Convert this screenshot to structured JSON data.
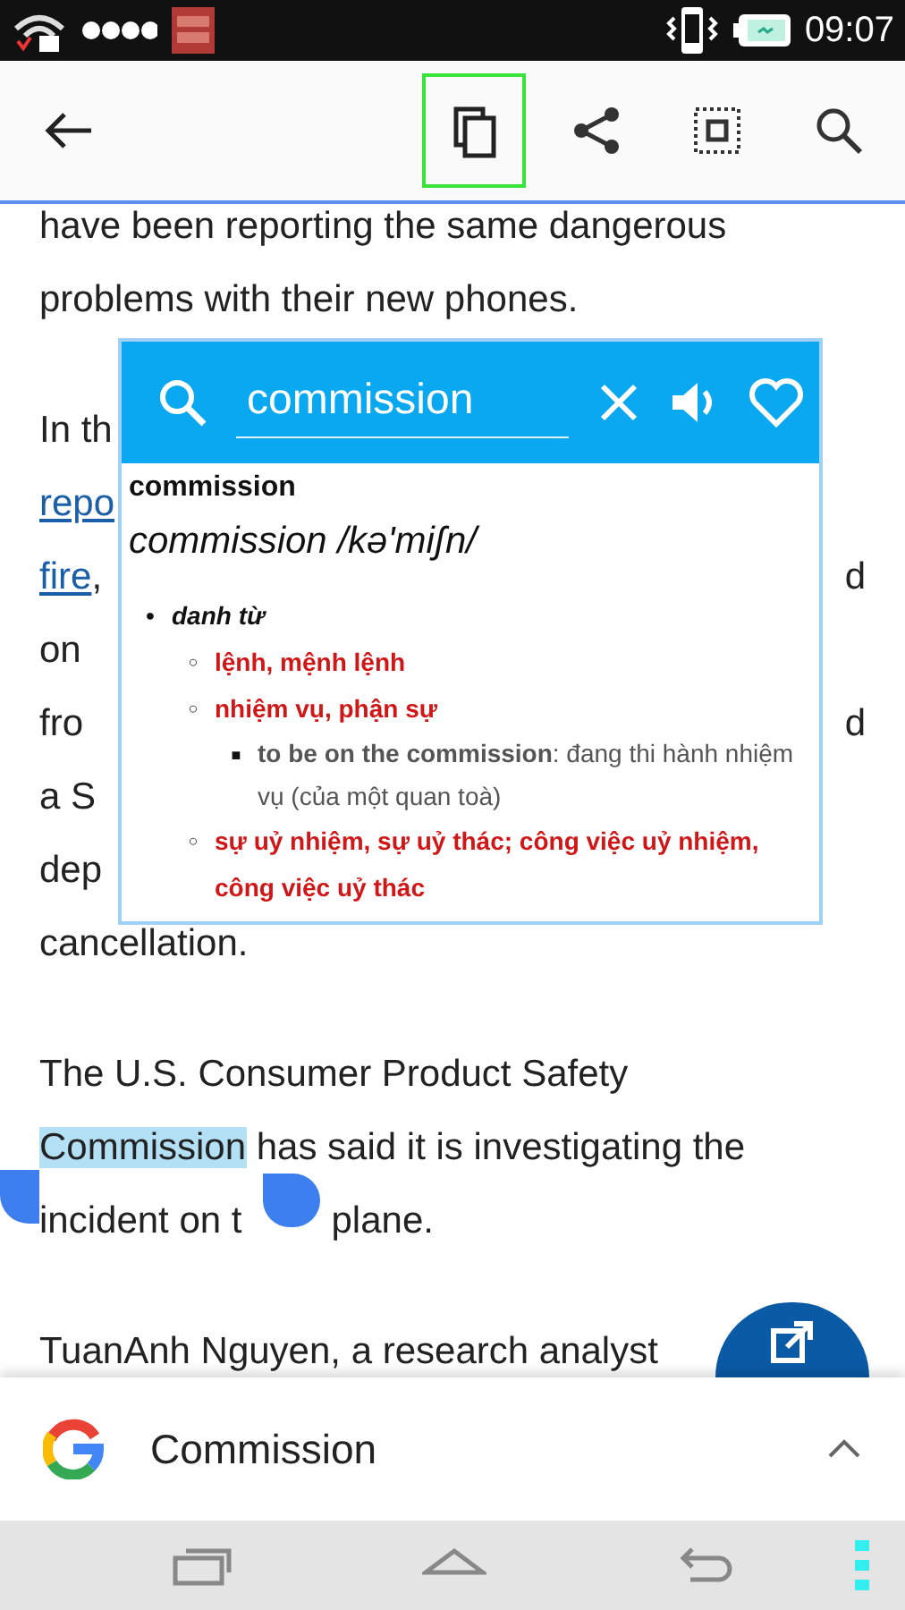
{
  "status_bar": {
    "time": "09:07"
  },
  "toolbar": {
    "buttons": [
      {
        "kind": "back",
        "selected": false
      },
      {
        "kind": "copy",
        "selected": true
      },
      {
        "kind": "share",
        "selected": false
      },
      {
        "kind": "select-all",
        "selected": false
      },
      {
        "kind": "search",
        "selected": false
      }
    ]
  },
  "article": {
    "paragraphs": [
      {
        "lines": [
          {
            "left": [
              {
                "text": "have been reporting the same dangerous",
                "kind": "plain"
              }
            ]
          },
          {
            "left": [
              {
                "text": "problems with their new phones.",
                "kind": "plain"
              }
            ]
          }
        ]
      },
      {
        "lines": [
          {
            "left": [
              {
                "text": "In th",
                "kind": "plain"
              }
            ]
          },
          {
            "left": [
              {
                "text": "repo",
                "kind": "link"
              }
            ]
          },
          {
            "left": [
              {
                "text": "fire",
                "kind": "link"
              },
              {
                "text": ",",
                "kind": "plain"
              }
            ],
            "right": [
              {
                "text": "d",
                "kind": "plain"
              }
            ]
          },
          {
            "left": [
              {
                "text": "on",
                "kind": "plain"
              }
            ]
          },
          {
            "left": [
              {
                "text": "fro",
                "kind": "plain"
              }
            ],
            "right": [
              {
                "text": "d",
                "kind": "plain"
              }
            ]
          },
          {
            "left": [
              {
                "text": "a S",
                "kind": "plain"
              }
            ]
          },
          {
            "left": [
              {
                "text": "dep",
                "kind": "plain"
              }
            ]
          },
          {
            "left": [
              {
                "text": "cancellation.",
                "kind": "plain"
              }
            ]
          }
        ]
      },
      {
        "lines": [
          {
            "left": [
              {
                "text": "The U.S. Consumer Product Safety",
                "kind": "plain"
              }
            ]
          },
          {
            "left": [
              {
                "text": "Commission",
                "kind": "highlight"
              },
              {
                "text": " has said it is investigating the",
                "kind": "plain"
              }
            ]
          },
          {
            "left": [
              {
                "text": "incident on t",
                "kind": "plain"
              },
              {
                "kind": "handle"
              },
              {
                "text": "plane.",
                "kind": "plain"
              }
            ]
          }
        ]
      },
      {
        "lines": [
          {
            "left": [
              {
                "text": "TuanAnh Nguyen, a research analyst",
                "kind": "plain"
              }
            ]
          }
        ]
      }
    ]
  },
  "popup": {
    "query": "commission",
    "headword": "commission",
    "pronunciation": "commission /kə'miʃn/",
    "entries": [
      {
        "marker": "●",
        "text": "danh từ",
        "kind": "pos",
        "children": [
          {
            "marker": "○",
            "text": "lệnh, mệnh lệnh",
            "kind": "meaning"
          },
          {
            "marker": "○",
            "text": "nhiệm vụ, phận sự",
            "kind": "meaning",
            "children": [
              {
                "marker": "■",
                "text": "**to be on the commission**: đang thi hành nhiệm vụ (của một quan toà)",
                "kind": "example"
              }
            ]
          },
          {
            "marker": "○",
            "text": "sự uỷ nhiệm, sự uỷ thác; công việc uỷ nhiệm, công việc uỷ thác",
            "kind": "meaning"
          }
        ]
      }
    ]
  },
  "google_bar": {
    "query": "Commission",
    "expanded": false
  }
}
